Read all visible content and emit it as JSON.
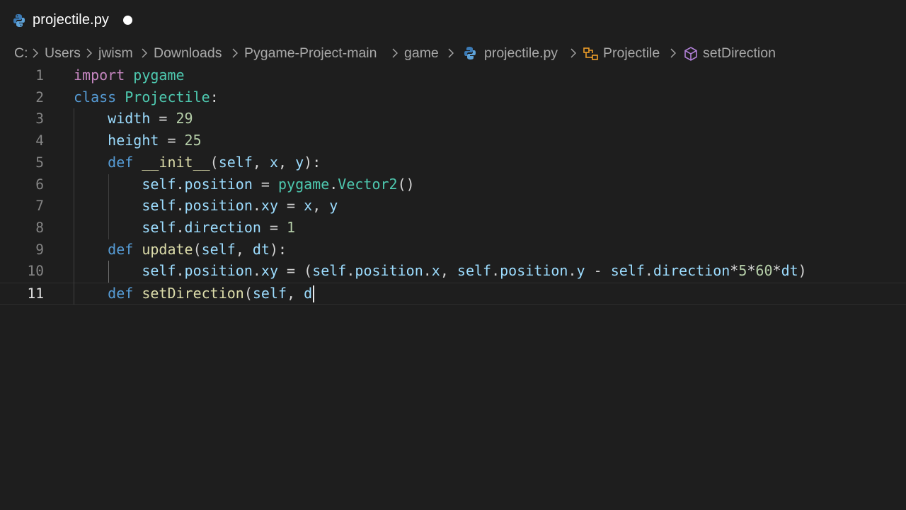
{
  "tab": {
    "filename": "projectile.py",
    "icon": "python-file-icon",
    "modified": true
  },
  "breadcrumb": {
    "items": [
      "C:",
      "Users",
      "jwism",
      "Downloads",
      "Pygame-Project-main",
      "game",
      "projectile.py",
      "Projectile",
      "setDirection"
    ]
  },
  "editor": {
    "active_line": 11,
    "line_numbers": [
      "1",
      "2",
      "3",
      "4",
      "5",
      "6",
      "7",
      "8",
      "9",
      "10",
      "11"
    ],
    "lines": [
      [
        {
          "t": "import",
          "c": "kw"
        },
        {
          "t": " ",
          "c": "pl"
        },
        {
          "t": "pygame",
          "c": "cls"
        }
      ],
      [
        {
          "t": "class",
          "c": "kwb"
        },
        {
          "t": " ",
          "c": "pl"
        },
        {
          "t": "Projectile",
          "c": "cls"
        },
        {
          "t": ":",
          "c": "pl"
        }
      ],
      [
        {
          "t": "    ",
          "c": "pl"
        },
        {
          "t": "width",
          "c": "var"
        },
        {
          "t": " = ",
          "c": "pl"
        },
        {
          "t": "29",
          "c": "num"
        }
      ],
      [
        {
          "t": "    ",
          "c": "pl"
        },
        {
          "t": "height",
          "c": "var"
        },
        {
          "t": " = ",
          "c": "pl"
        },
        {
          "t": "25",
          "c": "num"
        }
      ],
      [
        {
          "t": "    ",
          "c": "pl"
        },
        {
          "t": "def",
          "c": "kwb"
        },
        {
          "t": " ",
          "c": "pl"
        },
        {
          "t": "__init__",
          "c": "fn"
        },
        {
          "t": "(",
          "c": "pl"
        },
        {
          "t": "self",
          "c": "var"
        },
        {
          "t": ", ",
          "c": "pl"
        },
        {
          "t": "x",
          "c": "var"
        },
        {
          "t": ", ",
          "c": "pl"
        },
        {
          "t": "y",
          "c": "var"
        },
        {
          "t": "):",
          "c": "pl"
        }
      ],
      [
        {
          "t": "        ",
          "c": "pl"
        },
        {
          "t": "self",
          "c": "var"
        },
        {
          "t": ".",
          "c": "pl"
        },
        {
          "t": "position",
          "c": "var"
        },
        {
          "t": " = ",
          "c": "pl"
        },
        {
          "t": "pygame",
          "c": "cls"
        },
        {
          "t": ".",
          "c": "pl"
        },
        {
          "t": "Vector2",
          "c": "cls"
        },
        {
          "t": "()",
          "c": "pl"
        }
      ],
      [
        {
          "t": "        ",
          "c": "pl"
        },
        {
          "t": "self",
          "c": "var"
        },
        {
          "t": ".",
          "c": "pl"
        },
        {
          "t": "position",
          "c": "var"
        },
        {
          "t": ".",
          "c": "pl"
        },
        {
          "t": "xy",
          "c": "var"
        },
        {
          "t": " = ",
          "c": "pl"
        },
        {
          "t": "x",
          "c": "var"
        },
        {
          "t": ", ",
          "c": "pl"
        },
        {
          "t": "y",
          "c": "var"
        }
      ],
      [
        {
          "t": "        ",
          "c": "pl"
        },
        {
          "t": "self",
          "c": "var"
        },
        {
          "t": ".",
          "c": "pl"
        },
        {
          "t": "direction",
          "c": "var"
        },
        {
          "t": " = ",
          "c": "pl"
        },
        {
          "t": "1",
          "c": "num"
        }
      ],
      [
        {
          "t": "    ",
          "c": "pl"
        },
        {
          "t": "def",
          "c": "kwb"
        },
        {
          "t": " ",
          "c": "pl"
        },
        {
          "t": "update",
          "c": "fn"
        },
        {
          "t": "(",
          "c": "pl"
        },
        {
          "t": "self",
          "c": "var"
        },
        {
          "t": ", ",
          "c": "pl"
        },
        {
          "t": "dt",
          "c": "var"
        },
        {
          "t": "):",
          "c": "pl"
        }
      ],
      [
        {
          "t": "        ",
          "c": "pl"
        },
        {
          "t": "self",
          "c": "var"
        },
        {
          "t": ".",
          "c": "pl"
        },
        {
          "t": "position",
          "c": "var"
        },
        {
          "t": ".",
          "c": "pl"
        },
        {
          "t": "xy",
          "c": "var"
        },
        {
          "t": " = (",
          "c": "pl"
        },
        {
          "t": "self",
          "c": "var"
        },
        {
          "t": ".",
          "c": "pl"
        },
        {
          "t": "position",
          "c": "var"
        },
        {
          "t": ".",
          "c": "pl"
        },
        {
          "t": "x",
          "c": "var"
        },
        {
          "t": ", ",
          "c": "pl"
        },
        {
          "t": "self",
          "c": "var"
        },
        {
          "t": ".",
          "c": "pl"
        },
        {
          "t": "position",
          "c": "var"
        },
        {
          "t": ".",
          "c": "pl"
        },
        {
          "t": "y",
          "c": "var"
        },
        {
          "t": " - ",
          "c": "pl"
        },
        {
          "t": "self",
          "c": "var"
        },
        {
          "t": ".",
          "c": "pl"
        },
        {
          "t": "direction",
          "c": "var"
        },
        {
          "t": "*",
          "c": "pl"
        },
        {
          "t": "5",
          "c": "num"
        },
        {
          "t": "*",
          "c": "pl"
        },
        {
          "t": "60",
          "c": "num"
        },
        {
          "t": "*",
          "c": "pl"
        },
        {
          "t": "dt",
          "c": "var"
        },
        {
          "t": ")",
          "c": "pl"
        }
      ],
      [
        {
          "t": "    ",
          "c": "pl"
        },
        {
          "t": "def",
          "c": "kwb"
        },
        {
          "t": " ",
          "c": "pl"
        },
        {
          "t": "setDirection",
          "c": "fn"
        },
        {
          "t": "(",
          "c": "pl"
        },
        {
          "t": "self",
          "c": "var"
        },
        {
          "t": ", ",
          "c": "pl"
        },
        {
          "t": "d",
          "c": "var"
        }
      ]
    ]
  },
  "colors": {
    "background": "#1e1e1e",
    "keyword_import": "#c586c0",
    "keyword": "#569cd6",
    "class": "#4ec9b0",
    "function": "#dcdcaa",
    "variable": "#9cdcfe",
    "number": "#b5cea8",
    "plain": "#d4d4d4"
  }
}
